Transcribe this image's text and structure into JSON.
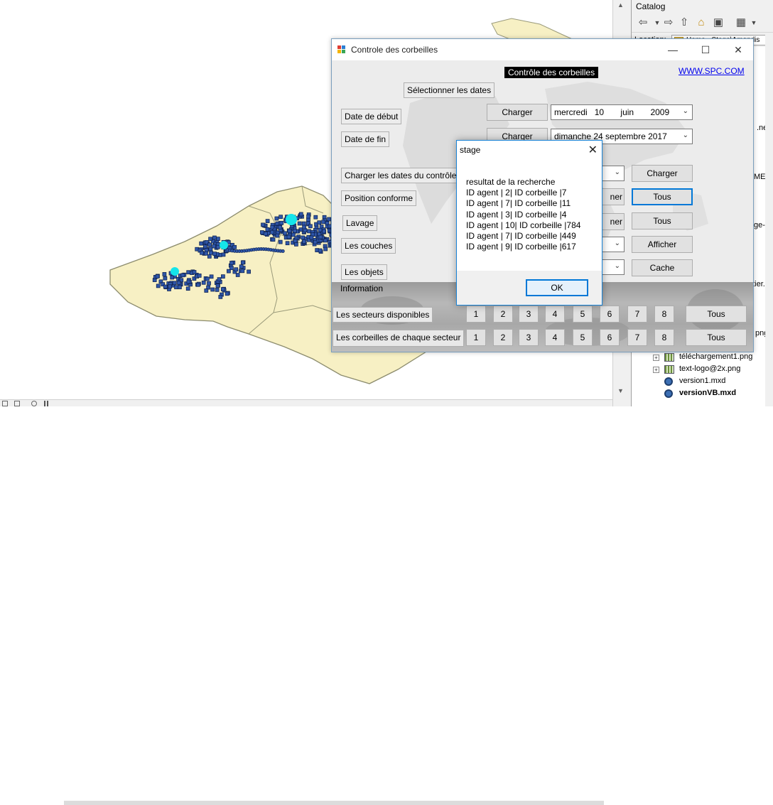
{
  "catalog": {
    "title": "Catalog",
    "location_label": "Location:",
    "location_value": "Home - Stage\\Amendis",
    "fragments": [
      ".net",
      "MENI",
      "ge-d",
      "utier.p",
      "png"
    ],
    "items": [
      {
        "label": "téléchargement1.png",
        "icon": "png-file-icon",
        "expandable": true
      },
      {
        "label": "text-logo@2x.png",
        "icon": "png-file-icon",
        "expandable": true
      },
      {
        "label": "version1.mxd",
        "icon": "mxd-file-icon",
        "expandable": false
      },
      {
        "label": "versionVB.mxd",
        "icon": "mxd-file-icon",
        "expandable": false
      }
    ]
  },
  "window": {
    "title": "Controle des corbeilles",
    "heading": "Contrôle des corbeilles",
    "link": "WWW.SPC.COM",
    "select_dates": "Sélectionner les dates",
    "start_date_label": "Date de début",
    "end_date_label": "Date de fin",
    "load_label": "Charger",
    "start_date": {
      "weekday": "mercredi",
      "day": "10",
      "month": "juin",
      "year": "2009"
    },
    "end_date": "dimanche 24 septembre 2017",
    "load_control_dates": "Charger les dates du contrôle",
    "position_conforme": "Position conforme",
    "lavage": "Lavage",
    "couches": "Les couches",
    "objets": "Les objets",
    "partial_charger": "ner",
    "charger_right": "Charger",
    "tous": "Tous",
    "afficher": "Afficher",
    "cache": "Cache",
    "information": "Information",
    "secteurs_label": "Les secteurs disponibles",
    "corbeilles_label": "Les corbeilles de chaque secteur",
    "sector_numbers": [
      "1",
      "2",
      "3",
      "4",
      "5",
      "6",
      "7",
      "8"
    ]
  },
  "dialog": {
    "title": "stage",
    "lines": [
      "resultat de la recherche",
      "ID agent | 2| ID corbeille |7",
      "ID agent | 7| ID corbeille |11",
      "ID agent | 3| ID corbeille |4",
      "ID agent | 10| ID corbeille |784",
      "ID agent | 7| ID corbeille |449",
      "ID agent | 9| ID corbeille |617"
    ],
    "ok": "OK"
  },
  "colors": {
    "map_fill": "#f7f0c4",
    "map_outline": "#9a9a7a",
    "point_fill": "#2f56a8",
    "highlight": "#15e5ea",
    "accent": "#0078d7"
  }
}
